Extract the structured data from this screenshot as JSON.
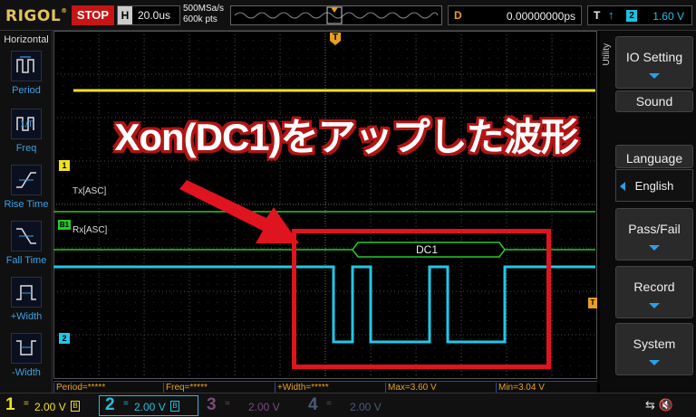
{
  "topbar": {
    "brand": "RIGOL",
    "run_state": "STOP",
    "timebase_key": "H",
    "timebase_value": "20.0us",
    "sample_rate": "500MSa/s",
    "memory_depth": "600k pts",
    "delay_key": "D",
    "delay_value": "0.00000000ps",
    "trigger_key": "T",
    "trigger_edge": "↑",
    "trigger_source": "2",
    "trigger_level": "1.60 V"
  },
  "left_panel": {
    "title": "Horizontal",
    "items": [
      {
        "label": "Period",
        "icon": "period-icon"
      },
      {
        "label": "Freq",
        "icon": "freq-icon"
      },
      {
        "label": "Rise Time",
        "icon": "rise-time-icon"
      },
      {
        "label": "Fall Time",
        "icon": "fall-time-icon"
      },
      {
        "label": "+Width",
        "icon": "pos-width-icon"
      },
      {
        "label": "-Width",
        "icon": "neg-width-icon"
      }
    ]
  },
  "waveform": {
    "tx_label": "Tx[ASC]",
    "rx_label": "Rx[ASC]",
    "decode_label": "DC1",
    "ch1_marker": "1",
    "bus_marker": "B1",
    "ch2_marker": "2",
    "trigger_marker": "T",
    "colors": {
      "ch1": "#f0e020",
      "ch2": "#20c8e8",
      "bus": "#28c828",
      "trigger": "#e8a020"
    }
  },
  "right_panel": {
    "menu_title": "Utility",
    "buttons": [
      "IO Setting",
      "Sound",
      "Language",
      "Pass/Fail",
      "Record",
      "System"
    ],
    "language_value": "English"
  },
  "measurements": [
    "Period=*****",
    "Freq=*****",
    "+Width=*****",
    "Max=3.60 V",
    "Min=3.04 V"
  ],
  "channels": [
    {
      "num": "1",
      "coupling": "=",
      "scale": "2.00 V",
      "color": "#f0e020"
    },
    {
      "num": "2",
      "coupling": "=",
      "scale": "2.00 V",
      "color": "#20c0e0"
    },
    {
      "num": "3",
      "coupling": "=",
      "scale": "2.00 V",
      "color": "#7a4a7a"
    },
    {
      "num": "4",
      "coupling": "=",
      "scale": "2.00 V",
      "color": "#4a5a7a"
    }
  ],
  "overlay": {
    "headline": "Xon(DC1)をアップした波形",
    "accent": "#e0141e"
  }
}
